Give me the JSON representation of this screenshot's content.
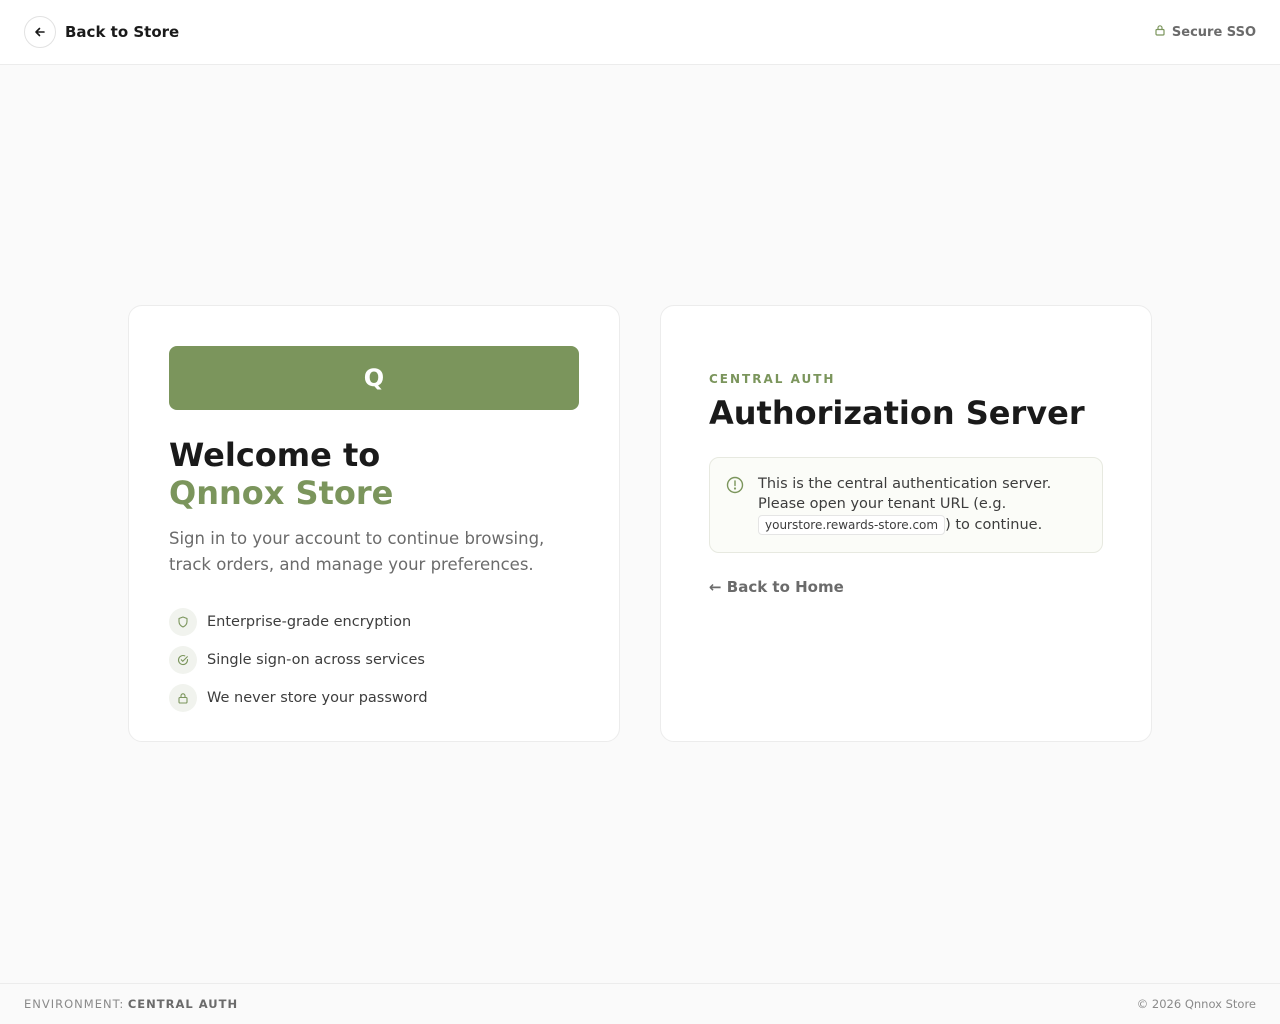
{
  "header": {
    "back_label": "Back to Store",
    "secure_label": "Secure SSO"
  },
  "welcome_card": {
    "logo_letter": "Q",
    "welcome_line": "Welcome to",
    "brand_name": "Qnnox Store",
    "subtitle": "Sign in to your account to continue browsing, track orders, and manage your preferences.",
    "features": [
      {
        "icon": "shield-icon",
        "label": "Enterprise-grade encryption"
      },
      {
        "icon": "check-circle-icon",
        "label": "Single sign-on across services"
      },
      {
        "icon": "lock-icon",
        "label": "We never store your password"
      }
    ]
  },
  "auth_card": {
    "eyebrow": "CENTRAL AUTH",
    "title": "Authorization Server",
    "notice_before": "This is the central authentication server. Please open your tenant URL (e.g.",
    "notice_code": "yourstore.rewards-store.com",
    "notice_after": ") to continue.",
    "home_link": "← Back to Home"
  },
  "footer": {
    "env_label": "ENVIRONMENT:",
    "env_value": "CENTRAL AUTH",
    "copyright": "© 2026 Qnnox Store"
  },
  "colors": {
    "accent": "#7b955c",
    "background": "#fafafa",
    "card": "#ffffff",
    "text": "#1a1a1a",
    "muted": "#6b6b6b"
  }
}
